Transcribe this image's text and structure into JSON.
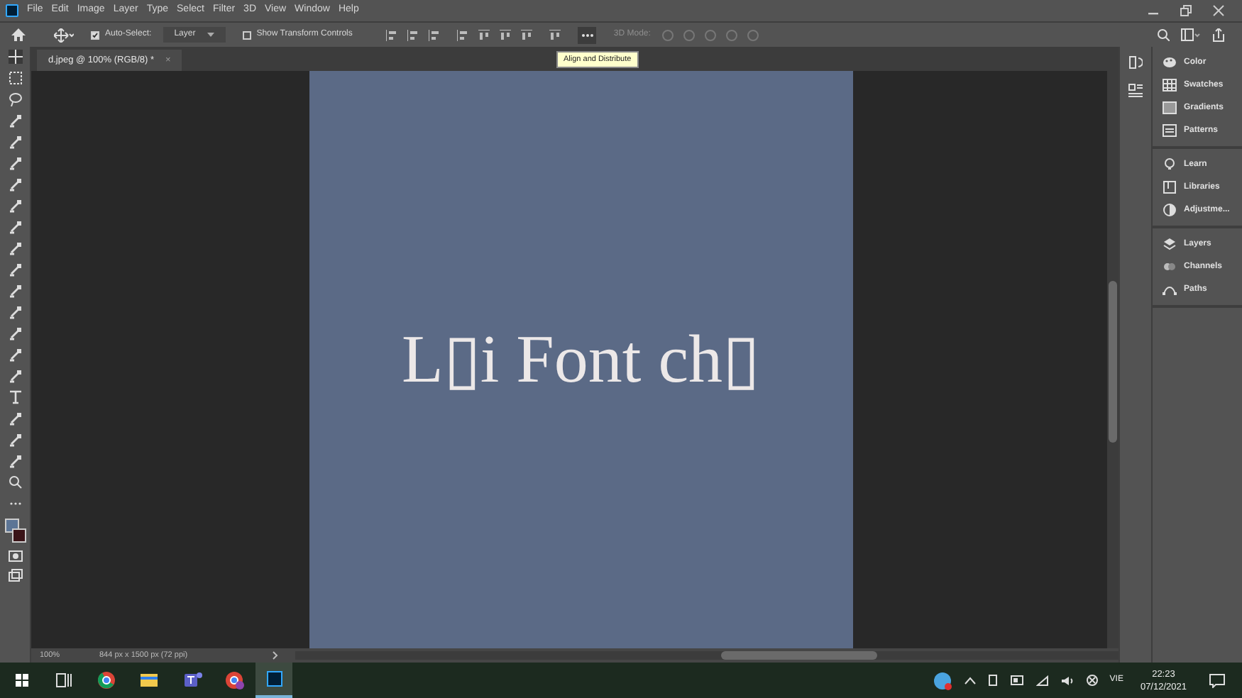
{
  "menu_bar": {
    "items": [
      "File",
      "Edit",
      "Image",
      "Layer",
      "Type",
      "Select",
      "Filter",
      "3D",
      "View",
      "Window",
      "Help"
    ]
  },
  "options_bar": {
    "auto_select": {
      "label": "Auto-Select:",
      "checked": true
    },
    "layer_dropdown": "Layer",
    "show_transform_controls": {
      "label": "Show Transform Controls",
      "checked": false
    },
    "mode_label": "3D Mode:",
    "tooltip": "Align and Distribute"
  },
  "document_tab": {
    "title": "d.jpeg @ 100% (RGB/8) *",
    "close": "×"
  },
  "canvas": {
    "text": "L▯i Font ch▯"
  },
  "panels": [
    {
      "items": [
        "Color",
        "Swatches",
        "Gradients",
        "Patterns"
      ]
    },
    {
      "items": [
        "Learn",
        "Libraries",
        "Adjustme..."
      ]
    },
    {
      "items": [
        "Layers",
        "Channels",
        "Paths"
      ]
    }
  ],
  "status_bar": {
    "zoom": "100%",
    "info": "844 px x 1500 px (72 ppi)"
  },
  "taskbar": {
    "language": "VIE",
    "time": "22:23",
    "date": "07/12/2021"
  }
}
